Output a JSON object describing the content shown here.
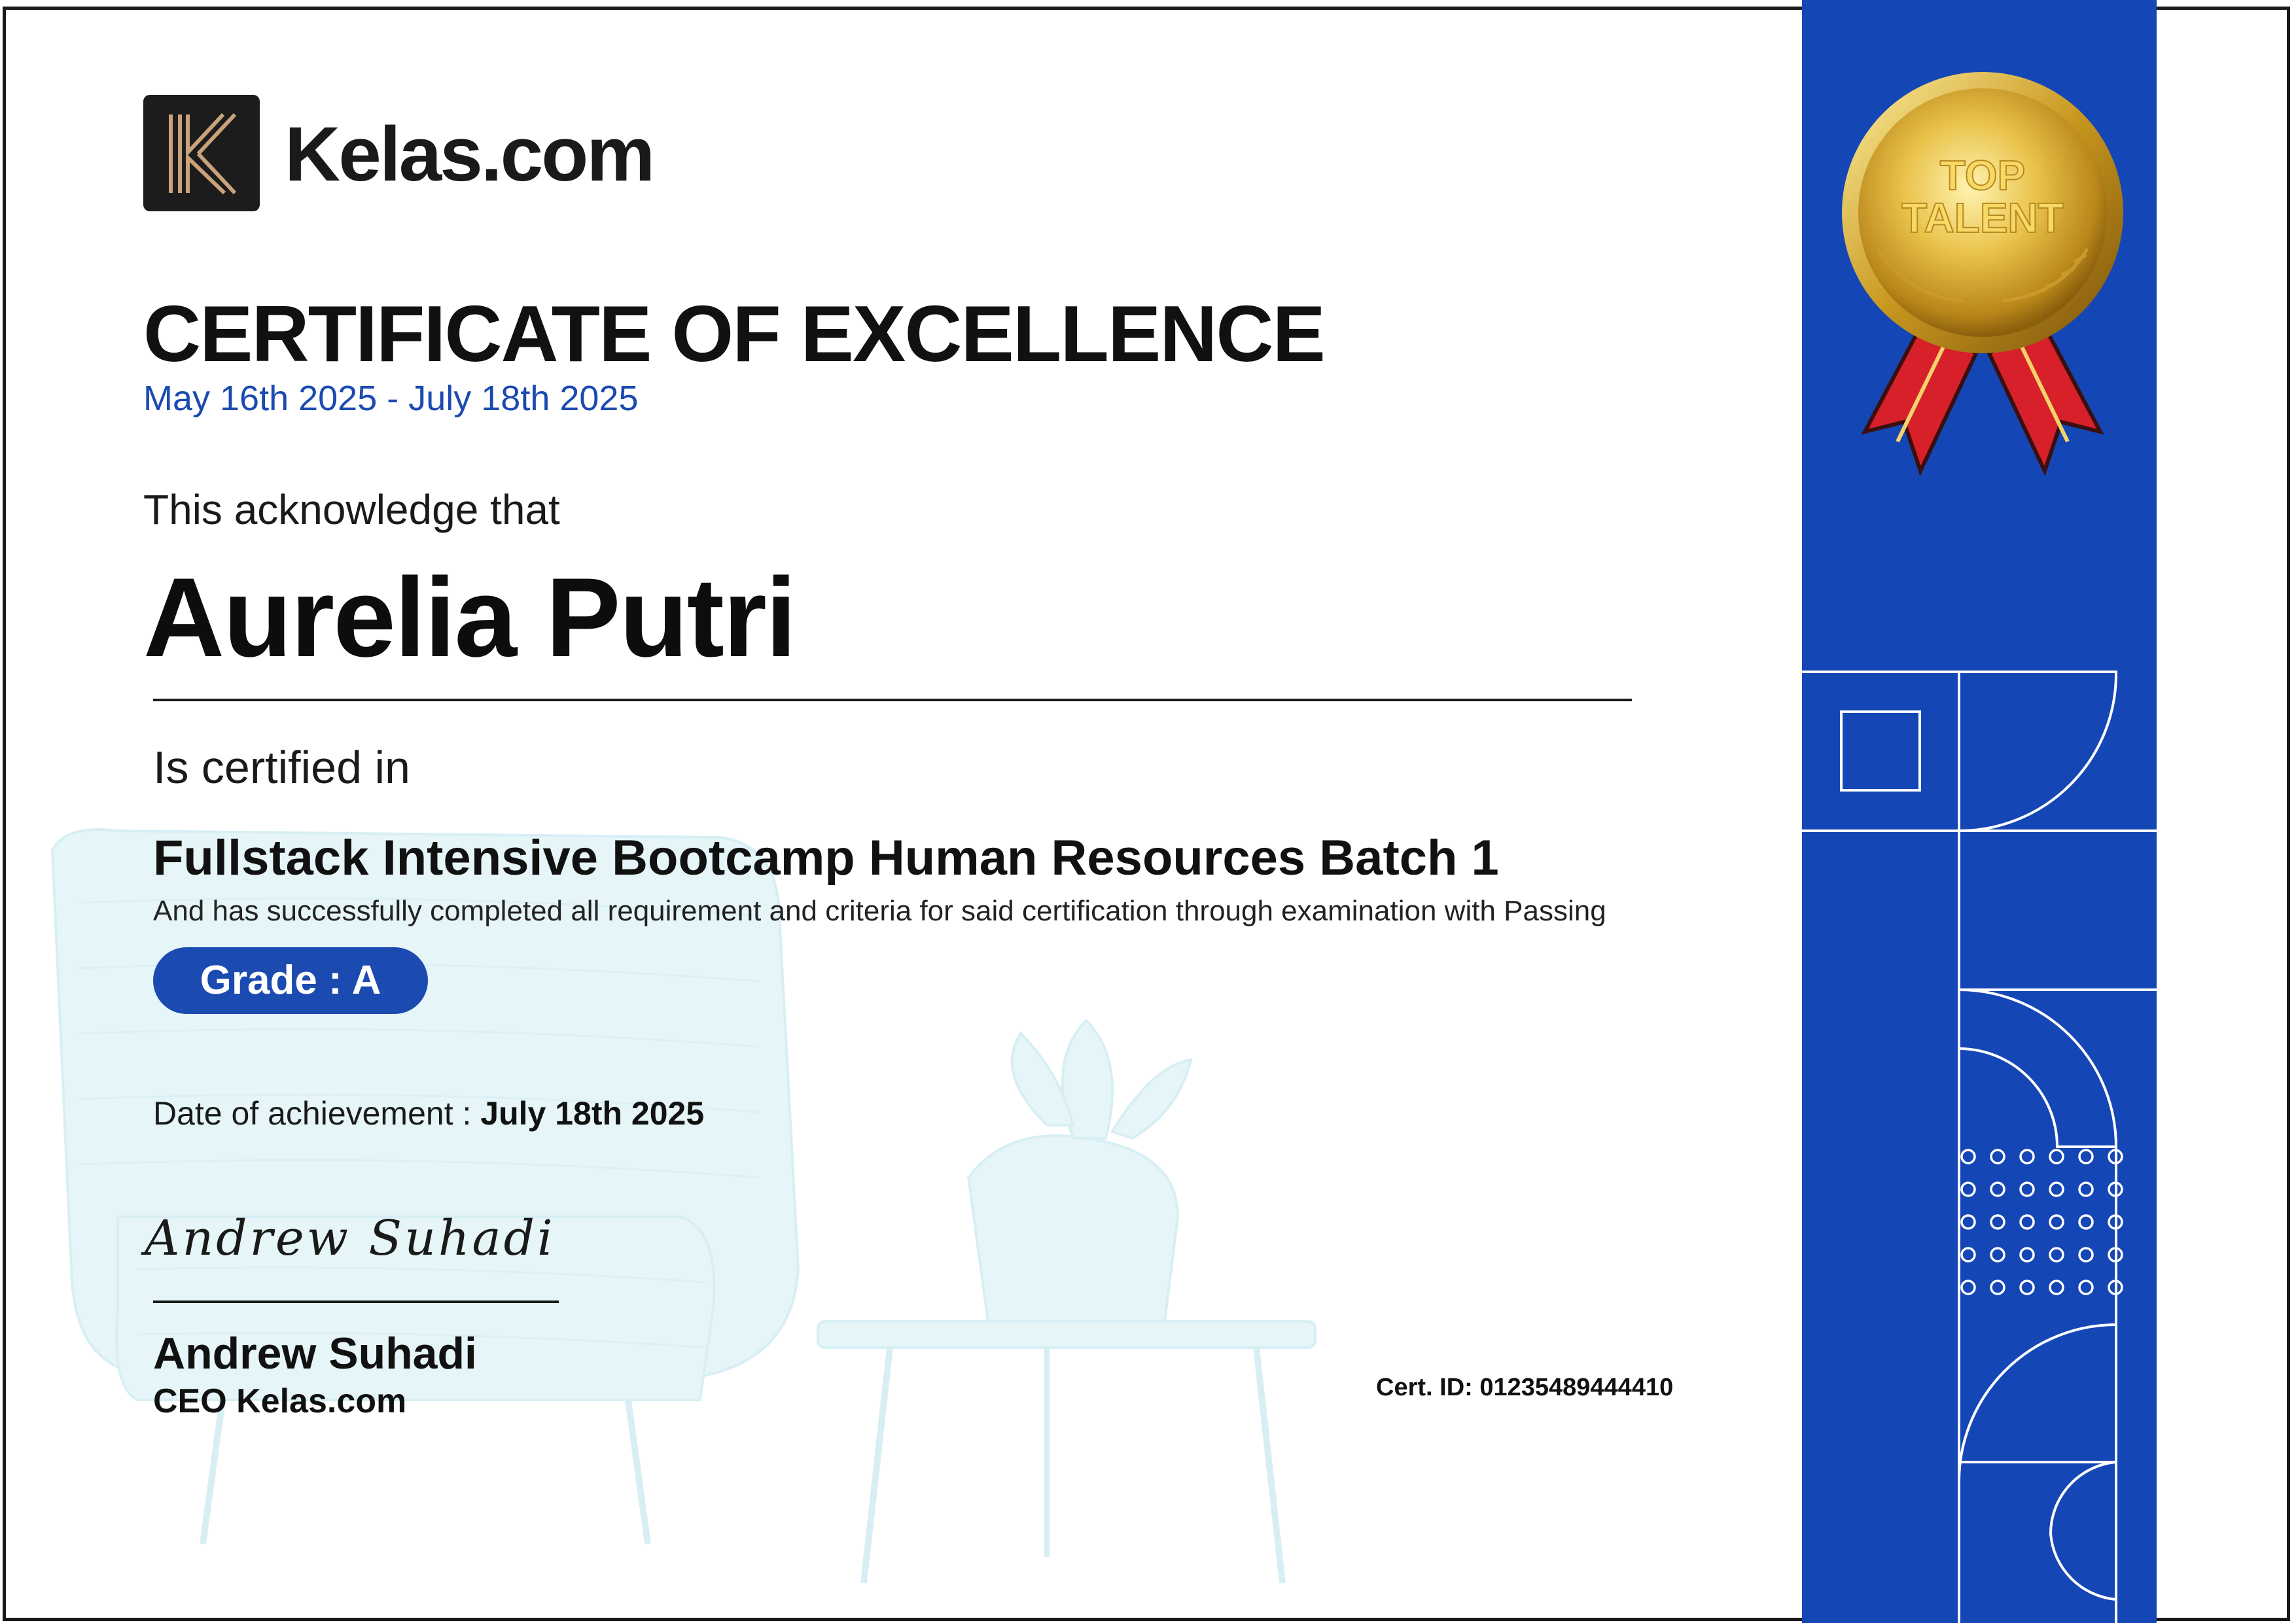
{
  "brand": {
    "logo_letter": "K",
    "name": "Kelas.com"
  },
  "certificate": {
    "title": "CERTIFICATE OF EXCELLENCE",
    "period": "May 16th 2025 - July 18th 2025",
    "acknowledge": "This acknowledge that",
    "recipient": "Aurelia Putri",
    "certified_in": "Is certified in",
    "course": "Fullstack Intensive Bootcamp Human Resources Batch 1",
    "description": "And has successfully completed all requirement and criteria for said certification through examination with Passing",
    "grade": "Grade : A",
    "achievement_label": "Date of achievement :",
    "achievement_date": "July 18th 2025",
    "signature_script": "Andrew Suhadi",
    "signer_name": "Andrew Suhadi",
    "signer_role": "CEO Kelas.com",
    "cert_id": "Cert. ID: 01235489444410"
  },
  "medal": {
    "line1": "TOP",
    "line2": "TALENT"
  },
  "colors": {
    "accent": "#1b4ab0",
    "side_panel": "#1546b5",
    "gold": "#d4a62a",
    "ribbon": "#d8202a"
  }
}
